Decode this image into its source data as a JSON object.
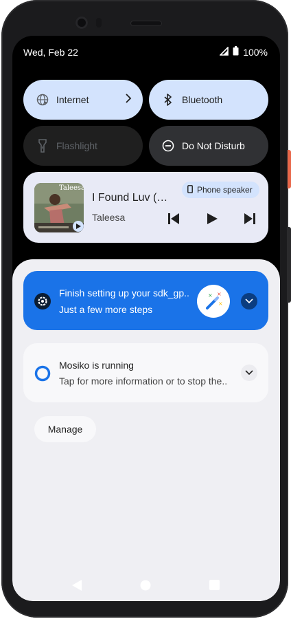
{
  "status": {
    "date": "Wed, Feb 22",
    "battery": "100%"
  },
  "tiles": {
    "internet": "Internet",
    "bluetooth": "Bluetooth",
    "flashlight": "Flashlight",
    "dnd": "Do Not Disturb"
  },
  "media": {
    "title": "I Found Luv (…",
    "artist": "Taleesa",
    "album_art_text": "Taleesa",
    "output": "Phone speaker",
    "controls": [
      "previous-icon",
      "play-icon",
      "next-icon"
    ]
  },
  "notifications": [
    {
      "title": "Finish setting up your sdk_gp..",
      "text": "Just a few more steps",
      "icon": "gear-icon"
    },
    {
      "title": "Mosiko is running",
      "text": "Tap for more information or to stop the..",
      "icon": "ring-icon"
    }
  ],
  "manage_label": "Manage",
  "colors": {
    "accent": "#1a73e8",
    "tile_on": "#d3e3fd",
    "shade": "#efeff3",
    "phone_button": "#e8674a"
  }
}
